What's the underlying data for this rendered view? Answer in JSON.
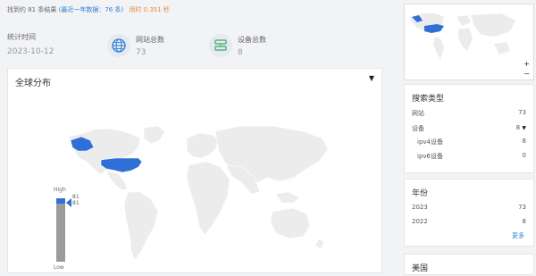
{
  "header": {
    "results": "找到约 81 条结果",
    "recent": "(最近一年数据：76 条)",
    "timing": "用时 0.351 秒"
  },
  "stats": [
    {
      "label": "统计时间",
      "value": "2023-10-12"
    },
    {
      "label": "网站总数",
      "value": "73"
    },
    {
      "label": "设备总数",
      "value": "8"
    }
  ],
  "map": {
    "title": "全球分布",
    "legend_high": "High",
    "legend_low": "Low",
    "legend_values": [
      "81",
      "81"
    ]
  },
  "sidebar": {
    "search_type": {
      "title": "搜索类型",
      "items": [
        {
          "label": "网站",
          "count": "73"
        },
        {
          "label": "设备",
          "count": "8"
        },
        {
          "label": "ipv4设备",
          "count": "8"
        },
        {
          "label": "ipv6设备",
          "count": "0"
        }
      ]
    },
    "year": {
      "title": "年份",
      "items": [
        {
          "label": "2023",
          "count": "73"
        },
        {
          "label": "2022",
          "count": "8"
        }
      ],
      "more": "更多"
    },
    "country": {
      "title": "美国"
    }
  },
  "colors": {
    "highlight": "#2f6fd6",
    "land": "#ececec",
    "accent": "#2a7fd4"
  },
  "icons": [
    "globe-icon",
    "server-icon",
    "caret-down-icon",
    "zoom-in-icon",
    "zoom-out-icon"
  ]
}
